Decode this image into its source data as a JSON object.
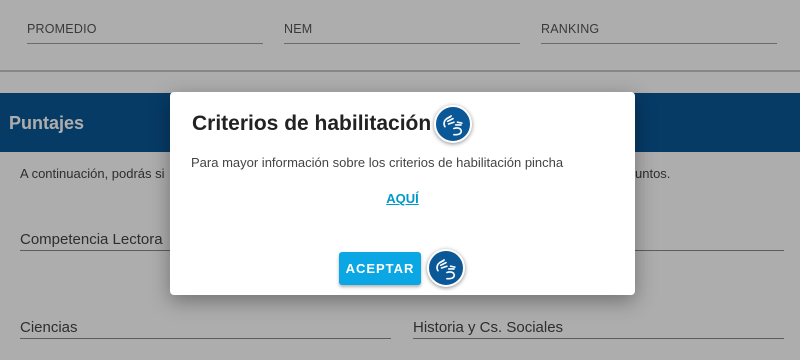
{
  "top_fields": [
    {
      "label": "PROMEDIO"
    },
    {
      "label": "NEM"
    },
    {
      "label": "RANKING"
    }
  ],
  "section": {
    "title": "Puntajes",
    "intro_left": "A continuación, podrás si",
    "intro_right": "untos."
  },
  "score_fields": {
    "competencia_lectora": "Competencia Lectora",
    "ciencias": "Ciencias",
    "historia": "Historia y Cs. Sociales"
  },
  "dialog": {
    "title": "Criterios de habilitación",
    "text": "Para mayor información sobre los criterios de habilitación pincha",
    "link": "AQUÍ",
    "accept_label": "ACEPTAR",
    "sign_icon": "sign-language-icon"
  },
  "colors": {
    "header_bg": "#0a5897",
    "accent_button": "#0aa7e4",
    "link": "#0099cc",
    "overlay": "rgba(0,0,0,0.32)"
  }
}
